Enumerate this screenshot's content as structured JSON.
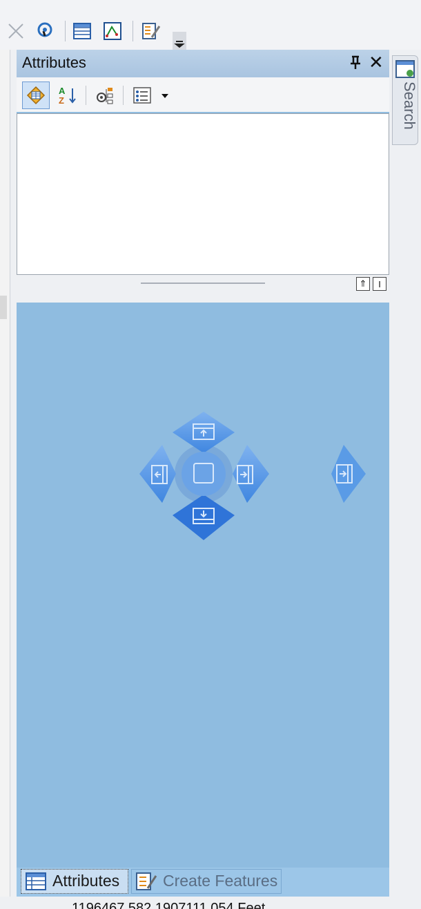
{
  "panel": {
    "title": "Attributes",
    "pin_icon": "pin-icon",
    "close_glyph": "✕"
  },
  "toolbar_icons": [
    "measure-icon",
    "identify-icon",
    "table-icon",
    "chart-icon",
    "edit-sketch-icon",
    "overflow-icon"
  ],
  "panel_toolbar_icons": [
    "attributes-icon",
    "sort-az-icon",
    "relationships-icon",
    "list-options-icon",
    "dropdown-arrow-icon"
  ],
  "splitter": {
    "collapse_glyph": "⇑",
    "expand_glyph": "I"
  },
  "search_tab": {
    "label": "Search",
    "icon": "search-window-icon"
  },
  "dock_targets": [
    "dock-top-icon",
    "dock-left-icon",
    "dock-center-icon",
    "dock-right-icon",
    "dock-bottom-icon",
    "dock-far-right-icon"
  ],
  "bottom_tabs": [
    {
      "label": "Attributes",
      "icon": "attributes-table-icon",
      "active": true
    },
    {
      "label": "Create Features",
      "icon": "create-features-icon",
      "active": false
    }
  ],
  "status": {
    "coordinates": "1196467.582  1907111.054 Feet"
  },
  "colors": {
    "panel_bg": "#8fbce0",
    "dock_blue": "#4a8ee0",
    "titlebar": "#b2cbe6"
  }
}
